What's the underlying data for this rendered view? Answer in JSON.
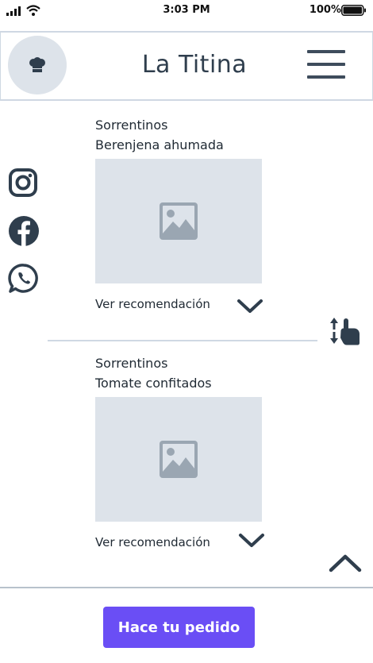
{
  "status_bar": {
    "time": "3:03 PM",
    "battery": "100%"
  },
  "header": {
    "title": "La Titina",
    "logo_icon": "chef-hat-icon",
    "menu_icon": "hamburger-menu-icon"
  },
  "social": [
    {
      "name": "instagram-icon"
    },
    {
      "name": "facebook-icon"
    },
    {
      "name": "whatsapp-icon"
    }
  ],
  "items": [
    {
      "title": "Sorrentinos",
      "subtitle": "Berenjena ahumada",
      "image_icon": "image-placeholder-icon",
      "recommendation_label": "Ver recomendación",
      "expand_icon": "chevron-down-icon"
    },
    {
      "title": "Sorrentinos",
      "subtitle": "Tomate confitados",
      "image_icon": "image-placeholder-icon",
      "recommendation_label": "Ver recomendación",
      "expand_icon": "chevron-down-icon"
    }
  ],
  "scroll_hint_icon": "swipe-vertical-icon",
  "scroll_top_icon": "chevron-up-icon",
  "order_button": {
    "label": "Hace tu pedido"
  },
  "colors": {
    "accent": "#6a4ef5",
    "placeholder": "#dde3ea",
    "icon_dark": "#2f3e4d"
  }
}
